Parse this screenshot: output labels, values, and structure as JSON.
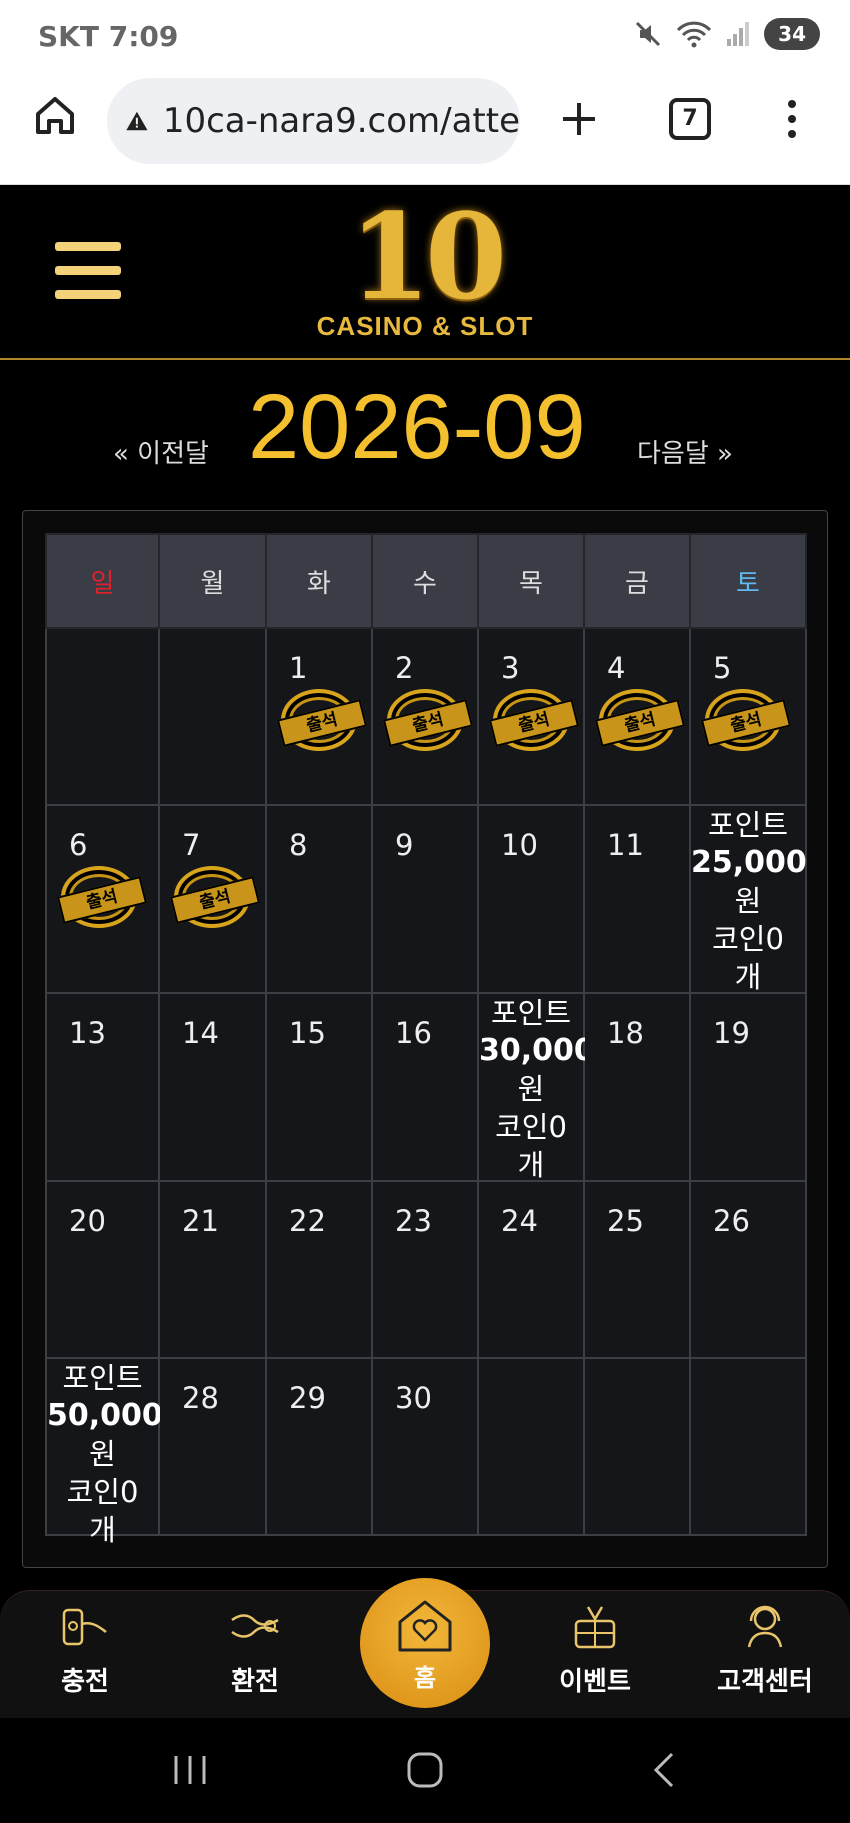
{
  "status_bar": {
    "carrier_time": "SKT 7:09",
    "battery": "34"
  },
  "browser": {
    "url": "10ca-nara9.com/atte",
    "tab_count": "7"
  },
  "header": {
    "logo_number": "10",
    "logo_text": "CASINO & SLOT"
  },
  "month_nav": {
    "prev_label": "« 이전달",
    "title": "2026-09",
    "next_label": "다음달 »"
  },
  "calendar": {
    "weekdays": [
      "일",
      "월",
      "화",
      "수",
      "목",
      "금",
      "토"
    ],
    "stamp_label": "출석",
    "days": {
      "d1": "1",
      "d2": "2",
      "d3": "3",
      "d4": "4",
      "d5": "5",
      "d6": "6",
      "d7": "7",
      "d8": "8",
      "d9": "9",
      "d10": "10",
      "d11": "11",
      "d13": "13",
      "d14": "14",
      "d15": "15",
      "d16": "16",
      "d18": "18",
      "d19": "19",
      "d20": "20",
      "d21": "21",
      "d22": "22",
      "d23": "23",
      "d24": "24",
      "d25": "25",
      "d26": "26",
      "d28": "28",
      "d29": "29",
      "d30": "30"
    },
    "rewards": {
      "d12": {
        "point_label": "포인트",
        "amount": "25,000",
        "unit": "원",
        "coin": "코인0",
        "coin_unit": "개"
      },
      "d17": {
        "point_label": "포인트",
        "amount": "30,000",
        "unit": "원",
        "coin": "코인0",
        "coin_unit": "개"
      },
      "d27": {
        "point_label": "포인트",
        "amount": "50,000",
        "unit": "원",
        "coin": "코인0",
        "coin_unit": "개"
      }
    }
  },
  "bottom_nav": {
    "deposit": "충전",
    "withdraw": "환전",
    "home": "홈",
    "event": "이벤트",
    "support": "고객센터"
  },
  "colors": {
    "gold": "#f4c02e",
    "sunday": "#e0202a",
    "saturday": "#5fb8ee"
  }
}
